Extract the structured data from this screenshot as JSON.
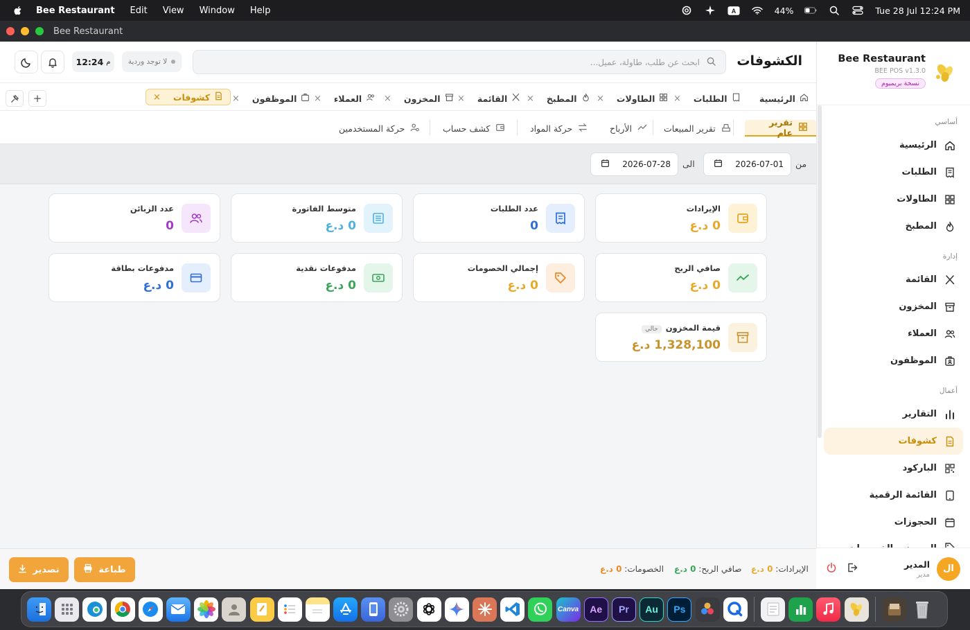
{
  "menubar": {
    "app_name": "Bee Restaurant",
    "menus": [
      "Edit",
      "View",
      "Window",
      "Help"
    ],
    "battery": "44%",
    "datetime": "Tue 28 Jul  12:24 PM"
  },
  "window": {
    "title": "Bee Restaurant"
  },
  "sidebar": {
    "brand_name": "Bee Restaurant",
    "version": "BEE POS v1.3.0",
    "premium_badge": "نسخة بريميوم",
    "sections": {
      "basic": "أساسي",
      "management": "إدارة",
      "business": "أعمال"
    },
    "items": {
      "home": "الرئيسية",
      "orders": "الطلبات",
      "tables": "الطاولات",
      "kitchen": "المطبخ",
      "menu": "القائمة",
      "inventory": "المخزون",
      "customers": "العملاء",
      "employees": "الموظفون",
      "reports": "التقارير",
      "statements": "كشوفات",
      "barcode": "الباركود",
      "digital_menu": "القائمة الرقمية",
      "reservations": "الحجوزات",
      "offers": "العروض والخصومات"
    },
    "user": {
      "initials": "ال",
      "name": "المدير",
      "role": "مدير"
    }
  },
  "topbar": {
    "page_title": "الكشوفات",
    "search_placeholder": "ابحث عن طلب، طاولة، عميل...",
    "shift_status": "لا توجد وردية",
    "time": "12:24",
    "time_suffix": "م"
  },
  "tabs": {
    "home": "الرئيسية",
    "orders": "الطلبات",
    "tables": "الطاولات",
    "kitchen": "المطبخ",
    "menu": "القائمة",
    "inventory": "المخزون",
    "customers": "العملاء",
    "employees": "الموظفون",
    "statements": "كشوفات",
    "close": "×",
    "add": "+"
  },
  "subtabs": {
    "general": "تقرير عام",
    "sales": "تقرير المبيعات",
    "profits": "الأرباح",
    "materials": "حركة المواد",
    "account": "كشف حساب",
    "users": "حركة المستخدمين"
  },
  "filter": {
    "from_label": "من",
    "from_date": "2026-07-01",
    "to_label": "الى",
    "to_date": "2026-07-28"
  },
  "cards": {
    "revenue": {
      "label": "الإيرادات",
      "value": "0 د.ع"
    },
    "orders_count": {
      "label": "عدد الطلبات",
      "value": "0"
    },
    "avg_invoice": {
      "label": "متوسط الفاتورة",
      "value": "0 د.ع"
    },
    "customers_count": {
      "label": "عدد الزبائن",
      "value": "0"
    },
    "net_profit": {
      "label": "صافي الربح",
      "value": "0 د.ع"
    },
    "total_discounts": {
      "label": "إجمالي الخصومات",
      "value": "0 د.ع"
    },
    "cash_payments": {
      "label": "مدفوعات نقدية",
      "value": "0 د.ع"
    },
    "card_payments": {
      "label": "مدفوعات بطاقة",
      "value": "0 د.ع"
    },
    "inventory_value": {
      "label": "قيمة المخزون",
      "badge": "حالي",
      "value": "1,328,100 د.ع"
    }
  },
  "colors": {
    "accent": "#f1a53a",
    "revenue": "#e8a92b",
    "orders": "#2f6fd6",
    "avg": "#4fb1e0",
    "customers": "#a13cc7",
    "profit": "#e8a92b",
    "discounts": "#e8a92b",
    "cash": "#3aa65a",
    "card": "#2f6fd6"
  },
  "footer": {
    "revenue_label": "الإيرادات:",
    "revenue_value": "0 د.ع",
    "profit_label": "صافي الربح:",
    "profit_value": "0 د.ع",
    "discounts_label": "الخصومات:",
    "discounts_value": "0 د.ع",
    "print_button": "طباعة",
    "export_button": "تصدير"
  },
  "dock": {
    "labels": [
      "Canva",
      "Ae",
      "Pr",
      "Au",
      "Ps"
    ]
  }
}
